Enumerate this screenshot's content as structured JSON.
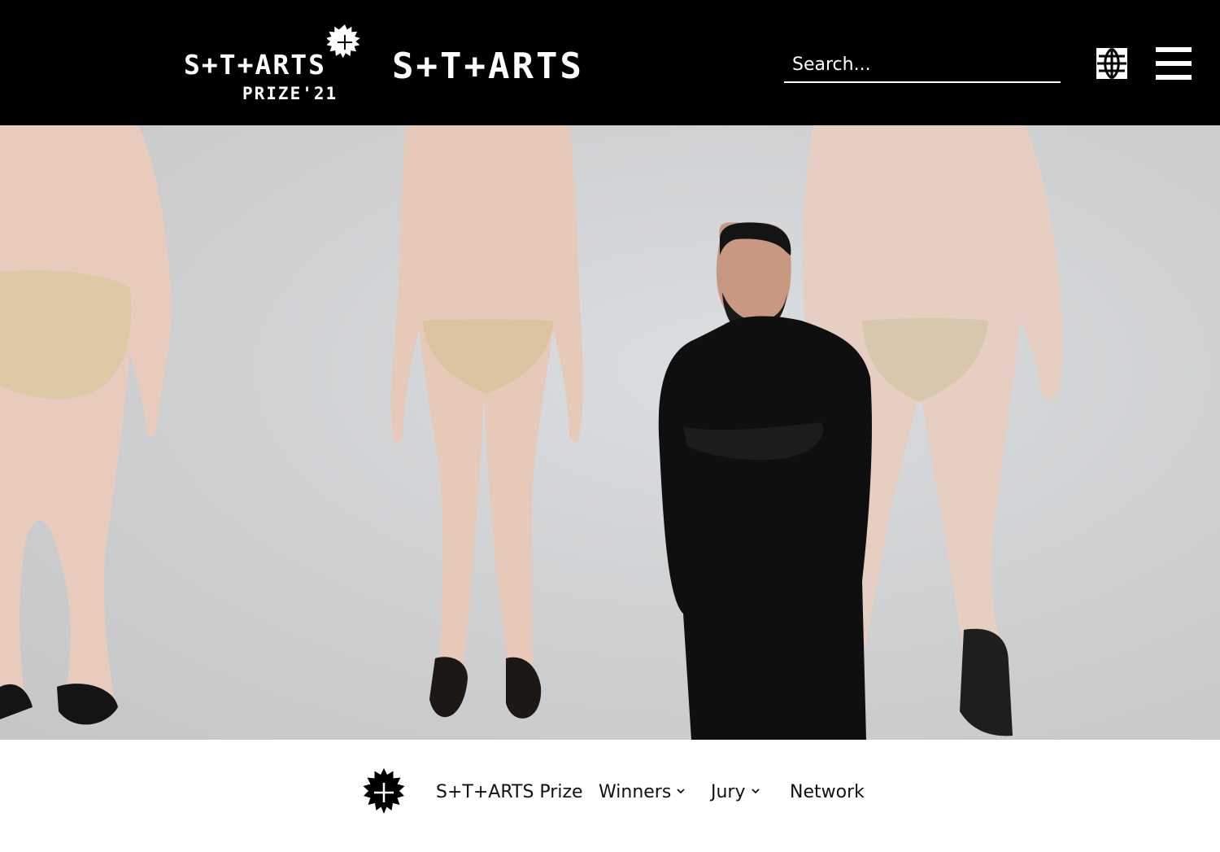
{
  "header": {
    "prize_logo": {
      "wordmark": "S+T+ARTS",
      "subtitle": "PRIZE'21"
    },
    "main_logo": "S+T+ARTS",
    "search": {
      "placeholder": "Search...",
      "value": ""
    },
    "language_icon": "globe-icon",
    "menu_icon": "hamburger-menu-icon"
  },
  "hero": {
    "image": "artist-portrait-with-body-figures"
  },
  "subnav": {
    "badge_icon": "plus-starburst-icon",
    "items": [
      {
        "label": "S+T+ARTS Prize",
        "has_dropdown": false
      },
      {
        "label": "Winners",
        "has_dropdown": true
      },
      {
        "label": "Jury",
        "has_dropdown": true
      },
      {
        "label": "Network",
        "has_dropdown": false
      }
    ]
  },
  "colors": {
    "header_bg": "#000000",
    "header_text": "#ffffff",
    "nav_text": "#111111",
    "page_bg": "#ffffff"
  }
}
